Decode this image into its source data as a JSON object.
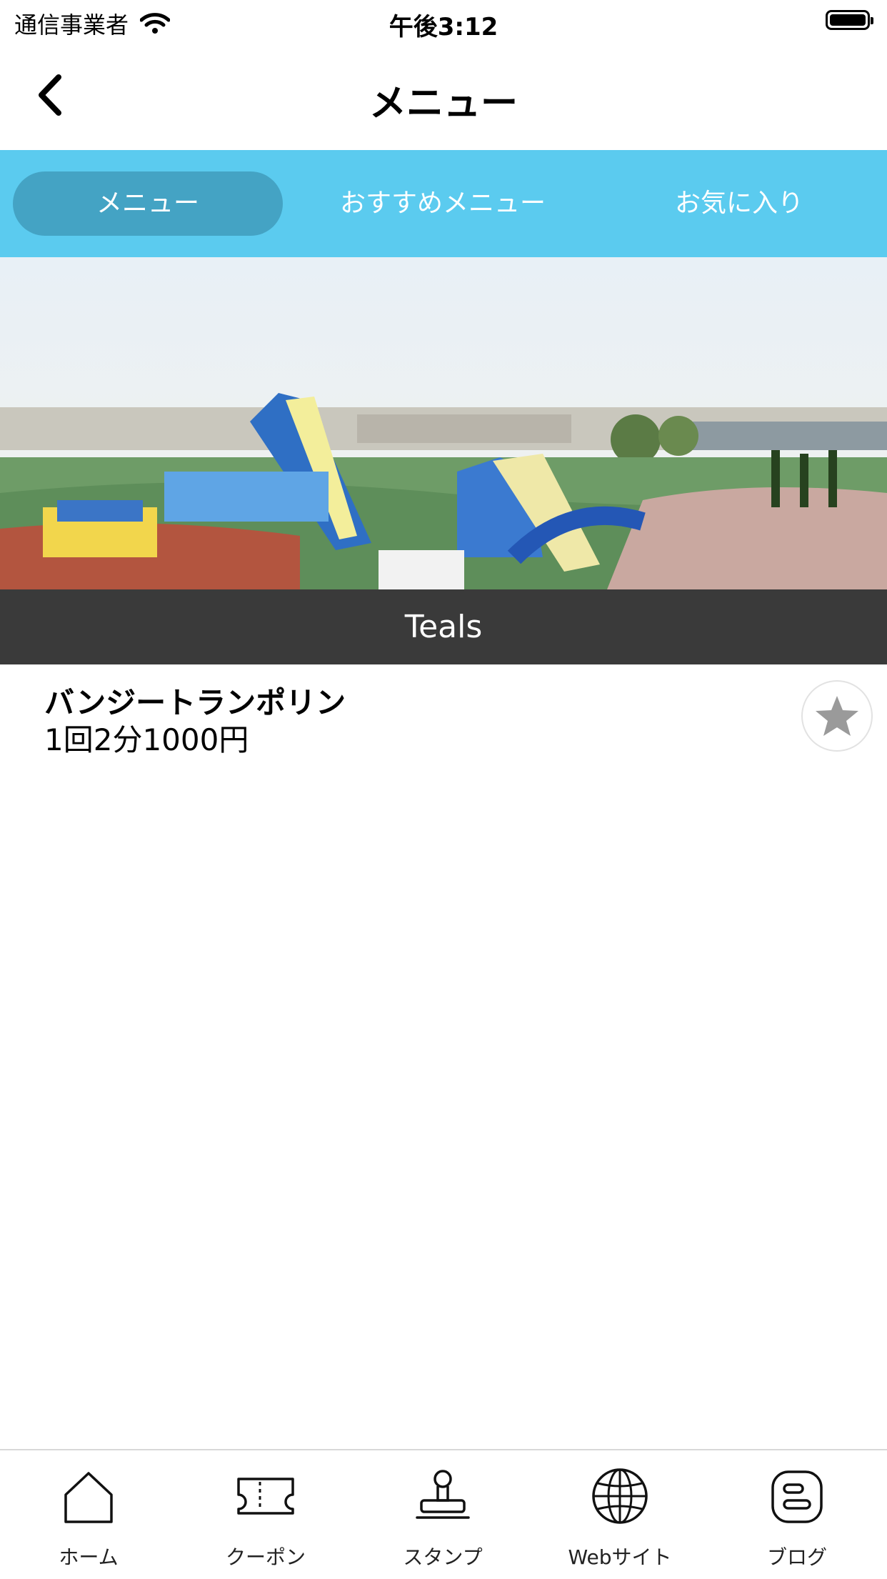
{
  "status_bar": {
    "carrier": "通信事業者",
    "time": "午後3:12"
  },
  "nav": {
    "title": "メニュー",
    "back_icon": "chevron-left-icon"
  },
  "tabs": [
    {
      "label": "メニュー",
      "active": true
    },
    {
      "label": "おすすめメニュー",
      "active": false
    },
    {
      "label": "お気に入り",
      "active": false
    }
  ],
  "hero": {
    "caption": "Teals"
  },
  "items": [
    {
      "title": "バンジートランポリン",
      "price": "1回2分1000円",
      "favorite_icon": "star-icon"
    }
  ],
  "bottom_nav": [
    {
      "label": "ホーム",
      "icon": "home-icon"
    },
    {
      "label": "クーポン",
      "icon": "ticket-icon"
    },
    {
      "label": "スタンプ",
      "icon": "stamp-icon"
    },
    {
      "label": "Webサイト",
      "icon": "globe-icon"
    },
    {
      "label": "ブログ",
      "icon": "blog-icon"
    }
  ],
  "colors": {
    "tab_bar": "#5bcbef",
    "tab_active": "#44a3c4",
    "caption_bar": "#3a3a3a"
  }
}
